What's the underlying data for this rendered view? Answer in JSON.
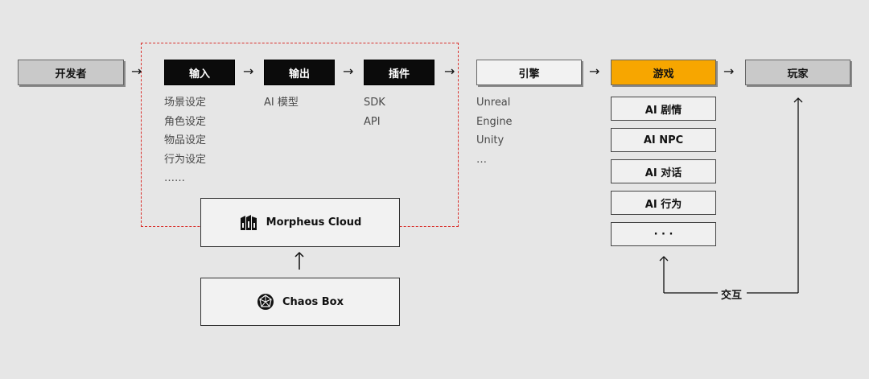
{
  "nodes": {
    "developer": "开发者",
    "input": "输入",
    "output": "输出",
    "plugin": "插件",
    "engine": "引擎",
    "game": "游戏",
    "player": "玩家"
  },
  "lists": {
    "input": [
      "场景设定",
      "角色设定",
      "物品设定",
      "行为设定",
      "……"
    ],
    "output": [
      "AI 模型"
    ],
    "plugin": [
      "SDK",
      "API"
    ],
    "engine": [
      "Unreal",
      "Engine",
      "Unity",
      "…"
    ]
  },
  "game_items": [
    "AI 剧情",
    "AI NPC",
    "AI 对话",
    "AI 行为",
    "· · ·"
  ],
  "platform": {
    "morpheus": "Morpheus Cloud",
    "chaos": "Chaos Box"
  },
  "interaction_label": "交互",
  "arrow_glyph": "→",
  "colors": {
    "background": "#e6e6e6",
    "game_accent": "#f7a600",
    "dashed_border": "#d9302c"
  }
}
